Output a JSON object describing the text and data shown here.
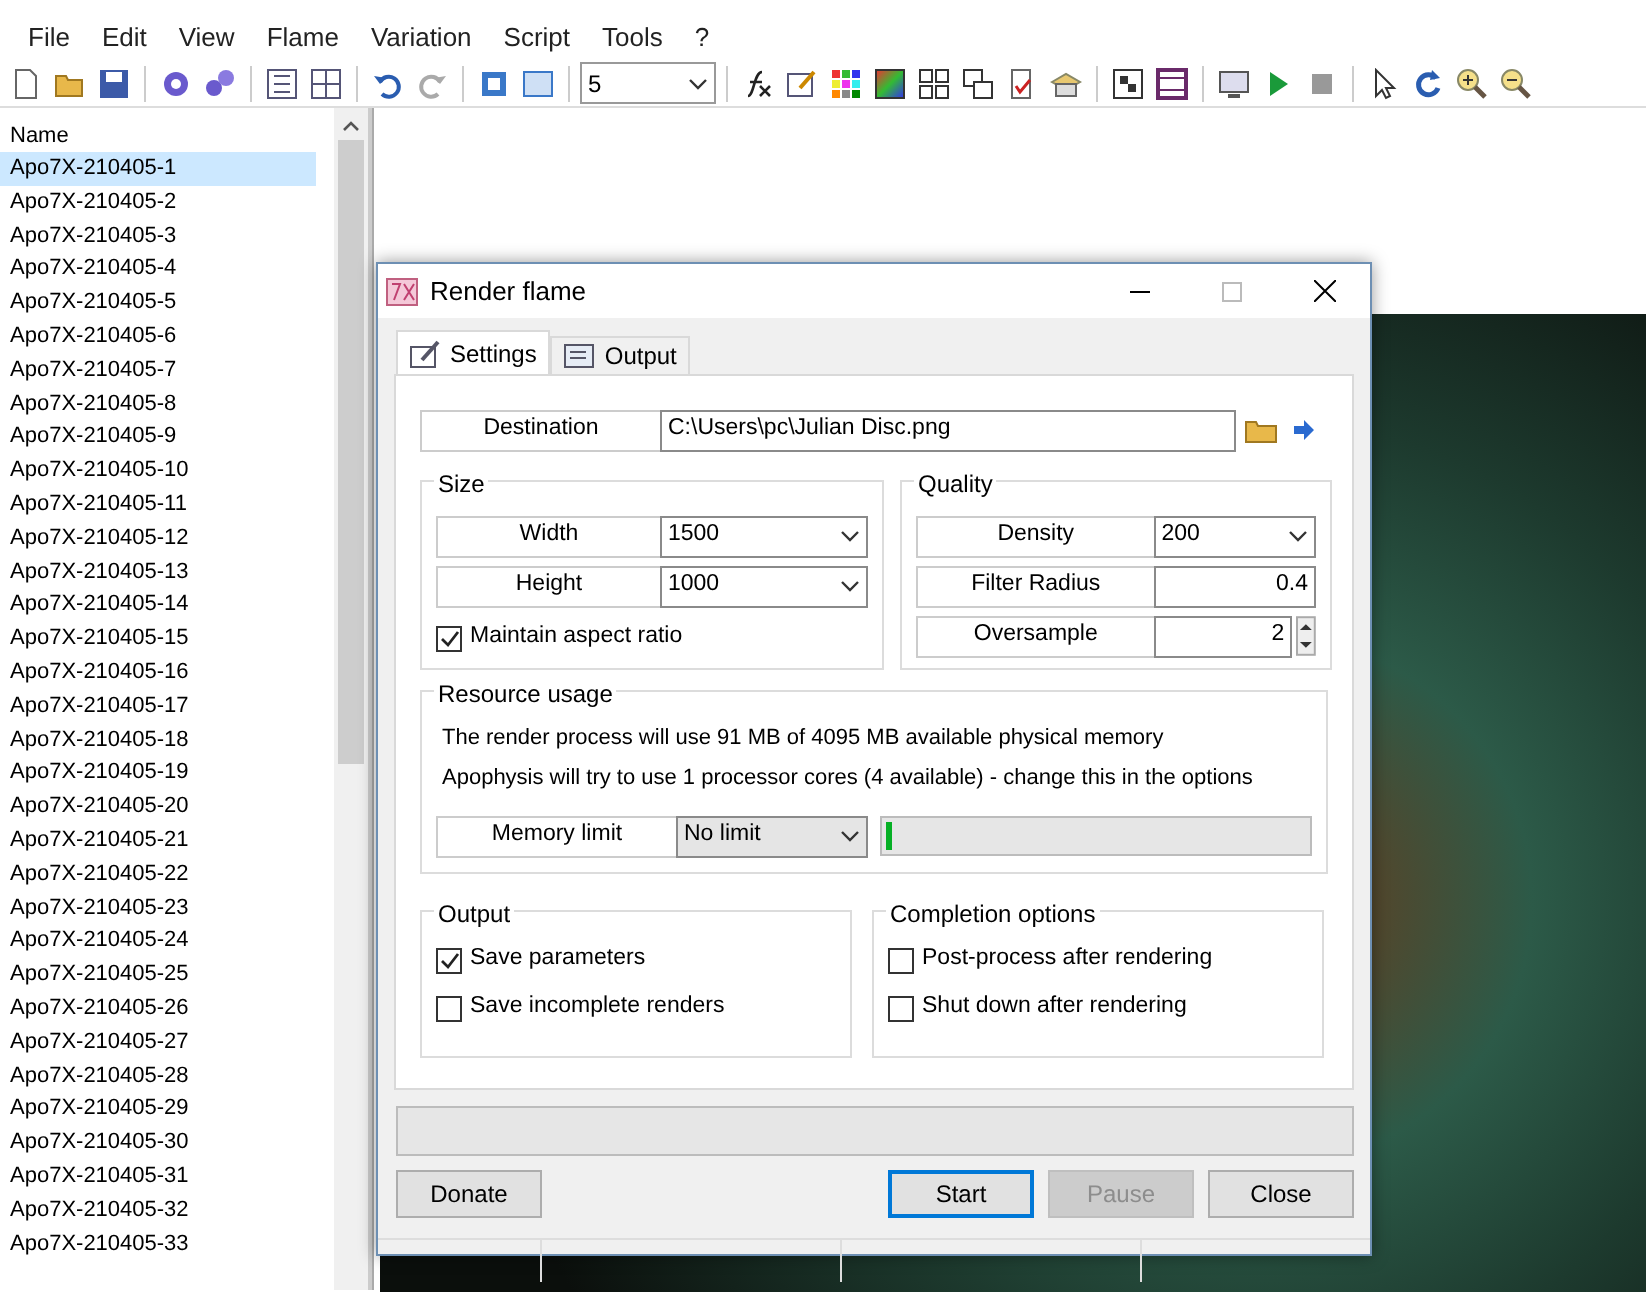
{
  "menu": [
    "File",
    "Edit",
    "View",
    "Flame",
    "Variation",
    "Script",
    "Tools",
    "?"
  ],
  "toolbar": {
    "zoom_value": "5"
  },
  "flame_list": {
    "column": "Name",
    "items": [
      {
        "label": "Apo7X-210405-1",
        "selected": true
      },
      {
        "label": "Apo7X-210405-2",
        "selected": false
      },
      {
        "label": "Apo7X-210405-3",
        "selected": false
      },
      {
        "label": "Apo7X-210405-4",
        "selected": false
      },
      {
        "label": "Apo7X-210405-5",
        "selected": false
      },
      {
        "label": "Apo7X-210405-6",
        "selected": false
      },
      {
        "label": "Apo7X-210405-7",
        "selected": false
      },
      {
        "label": "Apo7X-210405-8",
        "selected": false
      },
      {
        "label": "Apo7X-210405-9",
        "selected": false
      },
      {
        "label": "Apo7X-210405-10",
        "selected": false
      },
      {
        "label": "Apo7X-210405-11",
        "selected": false
      },
      {
        "label": "Apo7X-210405-12",
        "selected": false
      },
      {
        "label": "Apo7X-210405-13",
        "selected": false
      },
      {
        "label": "Apo7X-210405-14",
        "selected": false
      },
      {
        "label": "Apo7X-210405-15",
        "selected": false
      },
      {
        "label": "Apo7X-210405-16",
        "selected": false
      },
      {
        "label": "Apo7X-210405-17",
        "selected": false
      },
      {
        "label": "Apo7X-210405-18",
        "selected": false
      },
      {
        "label": "Apo7X-210405-19",
        "selected": false
      },
      {
        "label": "Apo7X-210405-20",
        "selected": false
      },
      {
        "label": "Apo7X-210405-21",
        "selected": false
      },
      {
        "label": "Apo7X-210405-22",
        "selected": false
      },
      {
        "label": "Apo7X-210405-23",
        "selected": false
      },
      {
        "label": "Apo7X-210405-24",
        "selected": false
      },
      {
        "label": "Apo7X-210405-25",
        "selected": false
      },
      {
        "label": "Apo7X-210405-26",
        "selected": false
      },
      {
        "label": "Apo7X-210405-27",
        "selected": false
      },
      {
        "label": "Apo7X-210405-28",
        "selected": false
      },
      {
        "label": "Apo7X-210405-29",
        "selected": false
      },
      {
        "label": "Apo7X-210405-30",
        "selected": false
      },
      {
        "label": "Apo7X-210405-31",
        "selected": false
      },
      {
        "label": "Apo7X-210405-32",
        "selected": false
      },
      {
        "label": "Apo7X-210405-33",
        "selected": false
      }
    ]
  },
  "dialog": {
    "title": "Render flame",
    "tabs": [
      {
        "label": "Settings",
        "selected": true
      },
      {
        "label": "Output",
        "selected": false
      }
    ],
    "destination": {
      "label": "Destination",
      "value": "C:\\Users\\pc\\Julian Disc.png"
    },
    "size": {
      "title": "Size",
      "fields": [
        {
          "label": "Width",
          "value": "1500"
        },
        {
          "label": "Height",
          "value": "1000"
        }
      ],
      "maintain_aspect": {
        "label": "Maintain aspect ratio",
        "checked": true
      }
    },
    "quality": {
      "title": "Quality",
      "fields": [
        {
          "kind": "dropdown",
          "label": "Density",
          "value": "200"
        },
        {
          "kind": "text",
          "label": "Filter Radius",
          "value": "0.4"
        },
        {
          "kind": "spin",
          "label": "Oversample",
          "value": "2"
        }
      ]
    },
    "resource": {
      "title": "Resource usage",
      "lines": [
        "The render process will use 91 MB of 4095 MB available physical memory",
        "Apophysis will try to use 1 processor cores (4 available) - change this in the options"
      ],
      "memory_limit": {
        "label": "Memory limit",
        "value": "No limit"
      },
      "memory_meter": {
        "level": 0.012
      }
    },
    "output": {
      "title": "Output",
      "options": [
        {
          "label": "Save parameters",
          "checked": true
        },
        {
          "label": "Save incomplete renders",
          "checked": false
        }
      ]
    },
    "completion": {
      "title": "Completion options",
      "options": [
        {
          "label": "Post-process after rendering",
          "checked": false
        },
        {
          "label": "Shut down after rendering",
          "checked": false
        }
      ]
    },
    "progress": {
      "level": 0
    },
    "buttons": [
      {
        "label": "Donate",
        "default": false,
        "disabled": false
      },
      {
        "label": "Start",
        "default": true,
        "disabled": false
      },
      {
        "label": "Pause",
        "default": false,
        "disabled": true
      },
      {
        "label": "Close",
        "default": false,
        "disabled": false
      }
    ]
  }
}
